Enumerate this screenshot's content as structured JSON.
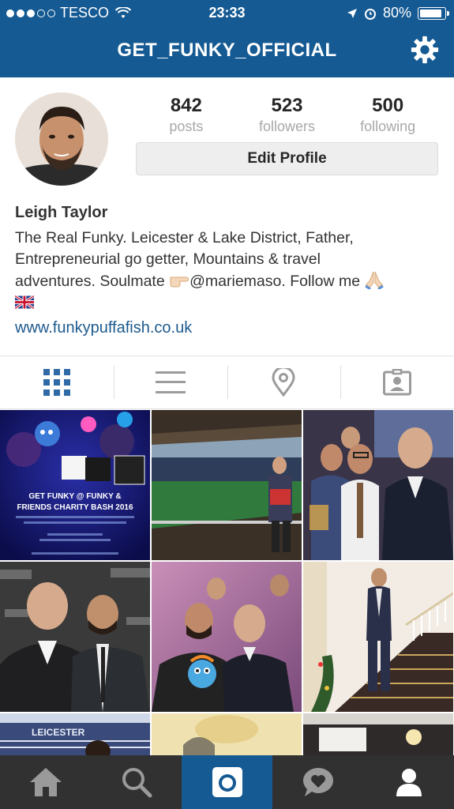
{
  "status_bar": {
    "carrier": "TESCO",
    "time": "23:33",
    "battery": "80%",
    "signal_bars_filled": 3,
    "signal_bars_total": 5
  },
  "header": {
    "title": "GET_FUNKY_OFFICIAL"
  },
  "profile": {
    "stats": [
      {
        "value": "842",
        "label": "posts"
      },
      {
        "value": "523",
        "label": "followers"
      },
      {
        "value": "500",
        "label": "following"
      }
    ],
    "edit_button": "Edit Profile",
    "name": "Leigh Taylor",
    "bio_line1": "The Real Funky. Leicester & Lake District, Father,",
    "bio_line2": "Entrepreneurial go getter, Mountains & travel",
    "bio_line3a": "adventures. Soulmate",
    "bio_handle": "@mariemaso. Follow me",
    "website": "www.funkypuffafish.co.uk"
  },
  "tabs": [
    {
      "icon": "grid-icon",
      "active": true
    },
    {
      "icon": "list-icon",
      "active": false
    },
    {
      "icon": "location-pin-icon",
      "active": false
    },
    {
      "icon": "tagged-photos-icon",
      "active": false
    }
  ],
  "posts": {
    "post1": {
      "line1": "GET FUNKY @ FUNKY &",
      "line2": "FRIENDS CHARITY BASH 2016"
    }
  },
  "bottom_nav": [
    {
      "icon": "home-icon",
      "active": false
    },
    {
      "icon": "search-icon",
      "active": false
    },
    {
      "icon": "camera-icon",
      "active": true
    },
    {
      "icon": "activity-icon",
      "active": false
    },
    {
      "icon": "profile-icon",
      "active": false
    }
  ],
  "colors": {
    "brand_blue": "#155a93",
    "link_blue": "#1d5a8e",
    "nav_bg": "#313131"
  }
}
